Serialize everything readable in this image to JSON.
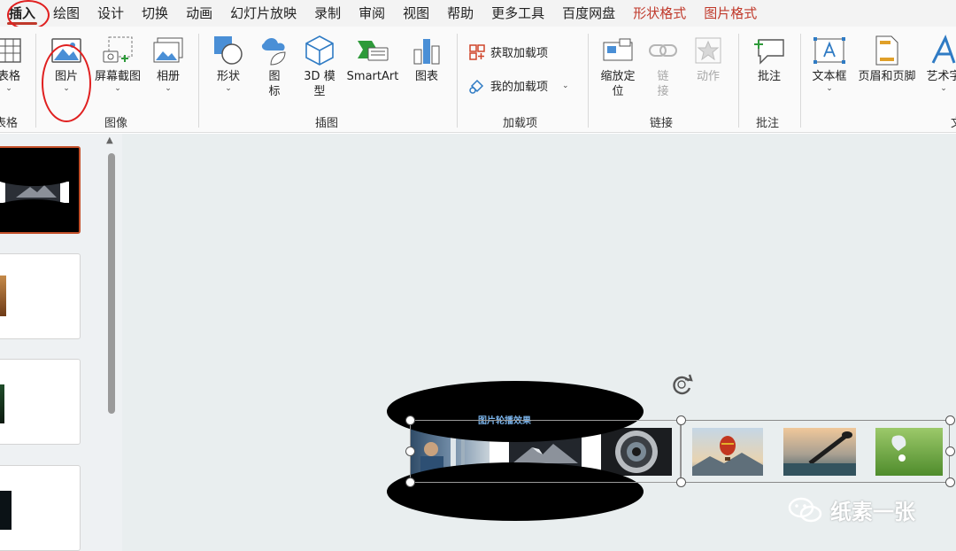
{
  "menu": {
    "items": [
      {
        "label": "插入",
        "active": true
      },
      {
        "label": "绘图"
      },
      {
        "label": "设计"
      },
      {
        "label": "切换"
      },
      {
        "label": "动画"
      },
      {
        "label": "幻灯片放映"
      },
      {
        "label": "录制"
      },
      {
        "label": "审阅"
      },
      {
        "label": "视图"
      },
      {
        "label": "帮助"
      },
      {
        "label": "更多工具"
      },
      {
        "label": "百度网盘"
      },
      {
        "label": "形状格式",
        "accent": true
      },
      {
        "label": "图片格式",
        "accent": true
      }
    ]
  },
  "ribbon": {
    "table_label": "表格",
    "table_group": "表格",
    "picture_label": "图片",
    "screenshot_label": "屏幕截图",
    "album_label": "相册",
    "image_group": "图像",
    "shapes_label": "形状",
    "icons_label_1": "图",
    "icons_label_2": "标",
    "model3d_label_1": "3D 模",
    "model3d_label_2": "型",
    "smartart_label": "SmartArt",
    "chart_label": "图表",
    "illustration_group": "插图",
    "get_addins_label": "获取加载项",
    "my_addins_label": "我的加载项",
    "addins_group": "加载项",
    "zoom_label_1": "缩放定",
    "zoom_label_2": "位",
    "link_label_1": "链",
    "link_label_2": "接",
    "action_label": "动作",
    "links_group": "链接",
    "comment_label": "批注",
    "comment_group": "批注",
    "textbox_label": "文本框",
    "headerfooter_label": "页眉和页脚",
    "wordart_label": "艺术字",
    "text_group_partial": "文"
  },
  "slide": {
    "title": "图片轮播效果"
  },
  "watermark": {
    "text": "纸素一张"
  },
  "colors": {
    "accent_red": "#c0392b",
    "annotation_red": "#e02020",
    "canvas_bg": "#e9eeef",
    "selected_thumb_border": "#c4502a"
  }
}
